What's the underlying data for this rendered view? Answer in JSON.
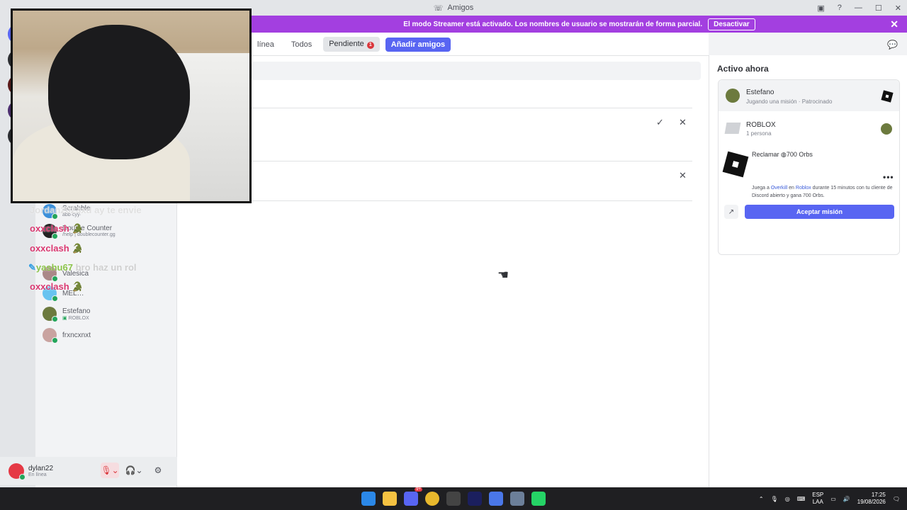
{
  "window": {
    "title": "Amigos"
  },
  "banner": {
    "message": "El modo Streamer está activado. Los nombres de usuario se mostrarán de forma parcial.",
    "button": "Desactivar",
    "close": "✕"
  },
  "tabs": [
    {
      "label": "línea"
    },
    {
      "label": "Todos"
    },
    {
      "label": "Pendiente",
      "badge": "1"
    },
    {
      "label": "Añadir amigos"
    }
  ],
  "dm_list": [
    {
      "name": "Scrabble",
      "sub": "abb·cyy·"
    },
    {
      "name": "Double Counter",
      "sub": "/help | doublecounter.gg"
    },
    {
      "name": "Valesica",
      "sub": ""
    },
    {
      "name": "MEL…",
      "sub": ""
    },
    {
      "name": "Estefano",
      "sub": "ROBLOX"
    },
    {
      "name": "frxncxnxt",
      "sub": ""
    }
  ],
  "overlay_chat": [
    {
      "user": "Jordan2023xd",
      "text": "ay te envie"
    },
    {
      "user": "oxxclash",
      "text": ""
    },
    {
      "user": "oxxclash",
      "text": ""
    },
    {
      "user": "yashu67",
      "text": "bro haz un rol"
    },
    {
      "user": "oxxclash",
      "text": ""
    }
  ],
  "user_panel": {
    "username": "dylan22",
    "status": "En línea"
  },
  "active_now": {
    "heading": "Activo ahora",
    "user_name": "Estefano",
    "user_activity": "Jugando una misión · Patrocinado",
    "game_name": "ROBLOX",
    "game_count": "1 persona",
    "quest_title": "Reclamar",
    "quest_reward": "700 Orbs",
    "quest_desc_a": "Juega a ",
    "quest_link1": "Overkill",
    "quest_desc_b": " en ",
    "quest_link2": "Roblox",
    "quest_desc_c": " durante 15 minutos con tu cliente de Discord abierto y gana 700 Orbs.",
    "accept_button": "Aceptar misión"
  },
  "taskbar": {
    "lang_top": "ESP",
    "lang_bottom": "LAA",
    "time": "17:25",
    "date": "19/08/2026",
    "discord_badge": "9+"
  }
}
